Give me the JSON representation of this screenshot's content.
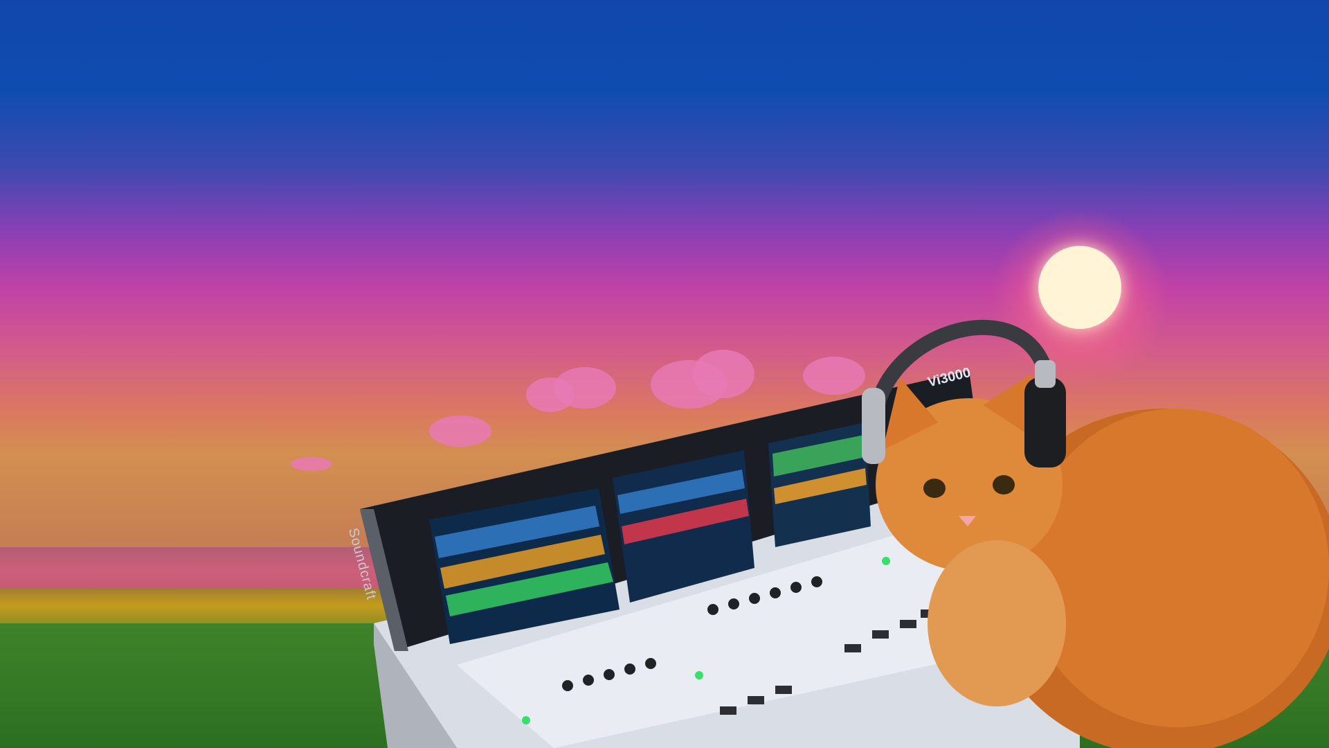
{
  "scene": {
    "description_tags": [
      "pixel-art-sunset",
      "mixing-console",
      "cat-with-headphones"
    ],
    "colors": {
      "sky_top": "#1147ad",
      "sky_mid": "#c042a6",
      "horizon": "#d38f50",
      "sea": "#cc5f79",
      "grass_band": "#c49c1c",
      "field": "#3e8329",
      "sun": "#fff4d6",
      "cloud": "#e879b5",
      "cat_fur": "#d8782d"
    }
  },
  "console": {
    "brand": "Soundcraft",
    "model": "Vi3000"
  }
}
